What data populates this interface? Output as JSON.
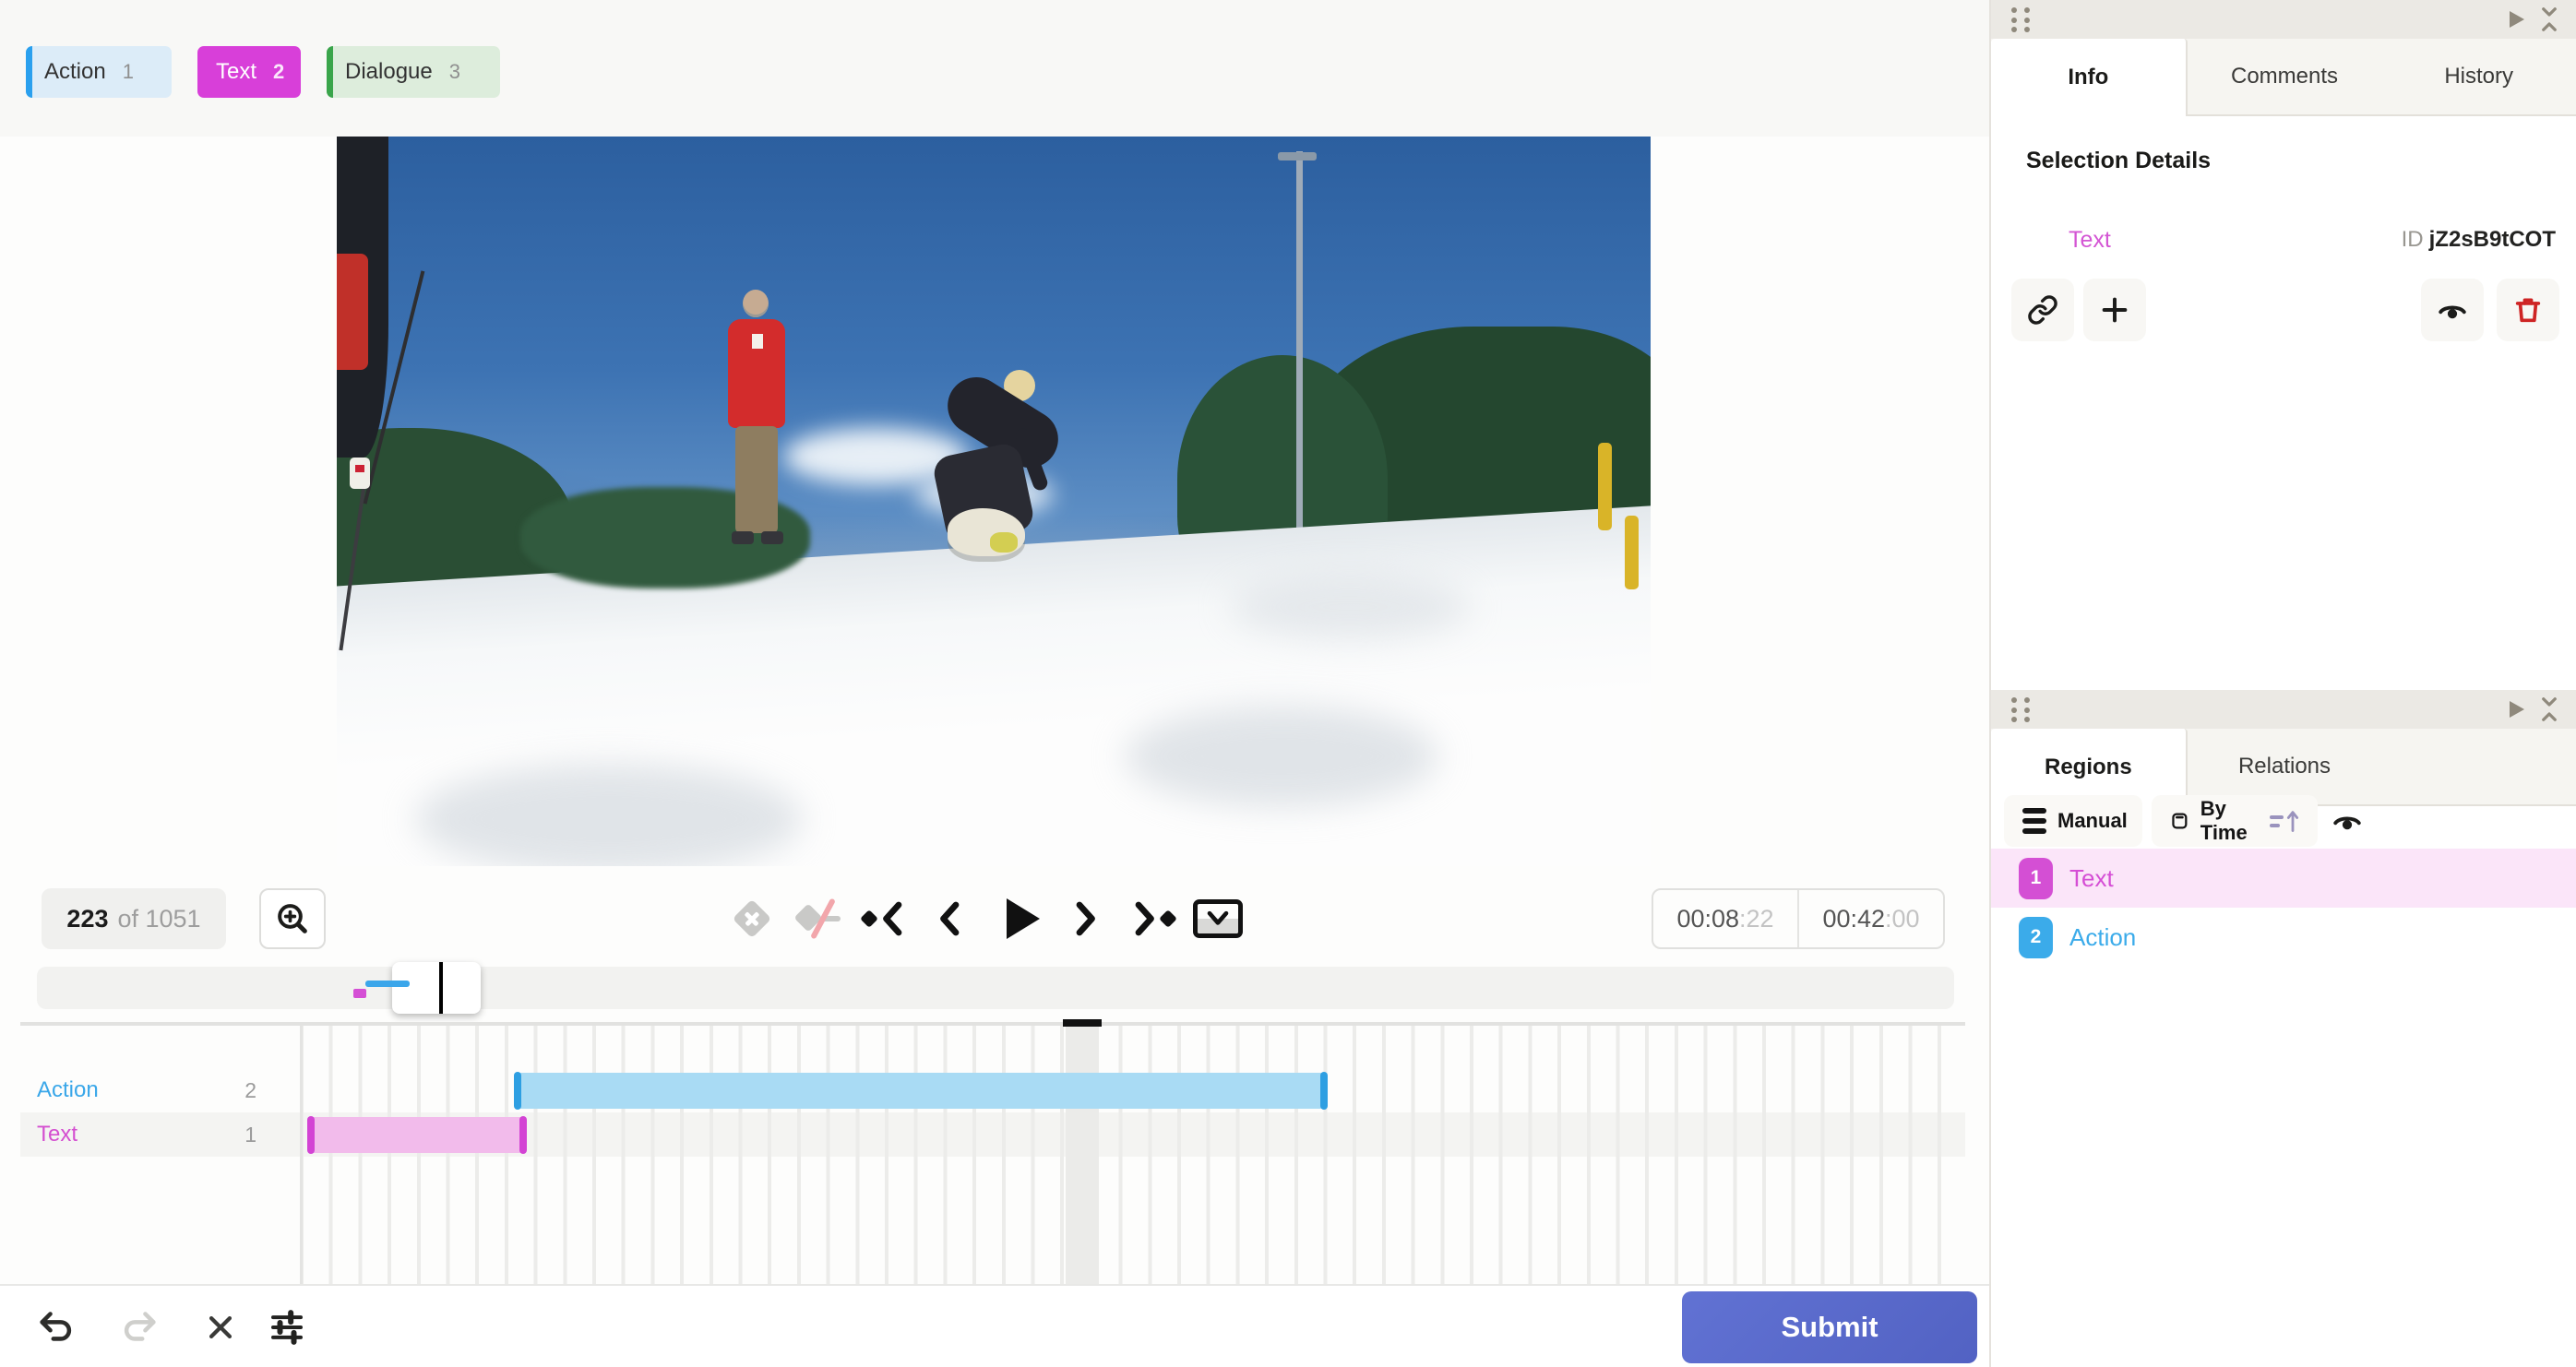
{
  "tags": {
    "items": [
      {
        "label": "Action",
        "hotkey": "1"
      },
      {
        "label": "Text",
        "hotkey": "2"
      },
      {
        "label": "Dialogue",
        "hotkey": "3"
      }
    ]
  },
  "player": {
    "frame_current": "223",
    "frame_total": "of 1051",
    "position_time": "00:08",
    "position_frames": ":22",
    "duration_time": "00:42",
    "duration_frames": ":00"
  },
  "timeline": {
    "tracks": [
      {
        "label": "Action",
        "count": "2"
      },
      {
        "label": "Text",
        "count": "1"
      }
    ]
  },
  "footer": {
    "submit_label": "Submit"
  },
  "info_panel": {
    "tabs": [
      "Info",
      "Comments",
      "History"
    ],
    "section_title": "Selection Details",
    "selection": {
      "label": "Text",
      "id_label": "ID",
      "id_value": "jZ2sB9tCOT"
    }
  },
  "regions_panel": {
    "tabs": [
      "Regions",
      "Relations"
    ],
    "toolbar": {
      "group": "Manual",
      "sort": "By Time"
    },
    "items": [
      {
        "index": "1",
        "label": "Text"
      },
      {
        "index": "2",
        "label": "Action"
      }
    ]
  },
  "colors": {
    "action_blue": "#3aa7e9",
    "text_magenta": "#d44fd4",
    "dialogue_green": "#3aa54b",
    "submit_indigo": "#5b69c8",
    "danger_red": "#ce2424"
  }
}
